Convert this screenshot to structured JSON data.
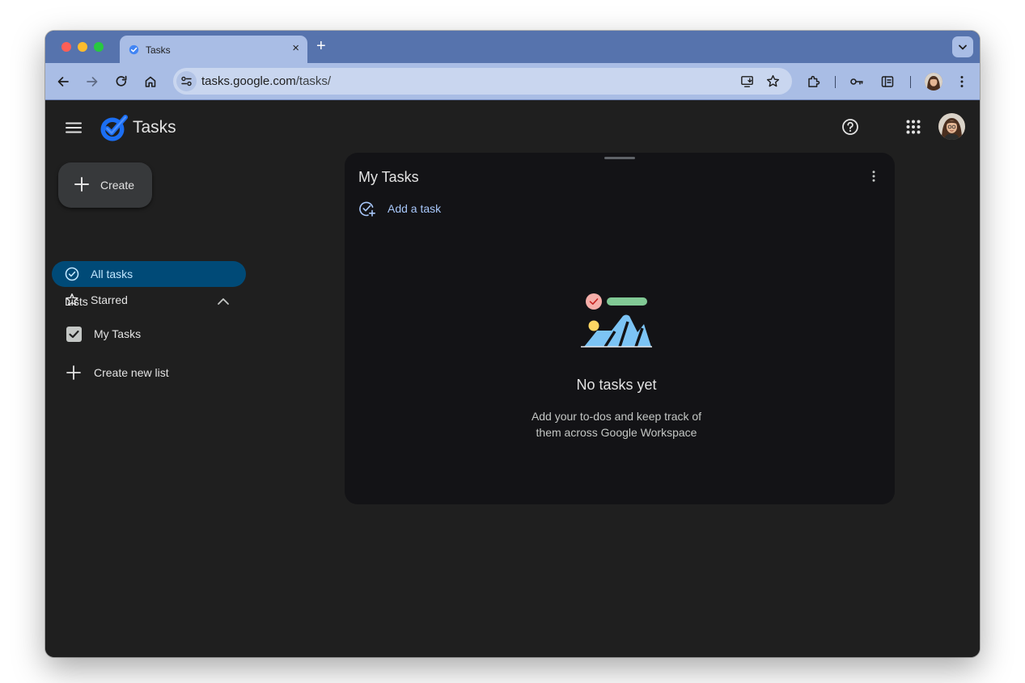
{
  "browser": {
    "tab_title": "Tasks",
    "new_tab_label": "+",
    "tab_close_label": "×",
    "url_host": "tasks.google.com",
    "url_path": "/tasks/"
  },
  "app": {
    "name": "Tasks",
    "create_label": "Create",
    "nav": [
      {
        "label": "All tasks",
        "icon": "check-circle-icon",
        "active": true
      },
      {
        "label": "Starred",
        "icon": "star-icon",
        "active": false
      }
    ],
    "lists_heading": "Lists",
    "lists": [
      {
        "label": "My Tasks",
        "checked": true
      }
    ],
    "create_list_label": "Create new list"
  },
  "panel": {
    "title": "My Tasks",
    "add_task_label": "Add a task",
    "empty_title": "No tasks yet",
    "empty_desc_line1": "Add your to-dos and keep track of",
    "empty_desc_line2": "them across Google Workspace"
  },
  "colors": {
    "tab_strip": "#5673ad",
    "toolbar": "#a9bde5",
    "app_background": "#1f1f1f",
    "panel_background": "#131316",
    "active_nav": "#004a77",
    "accent": "#a8c7fa"
  }
}
